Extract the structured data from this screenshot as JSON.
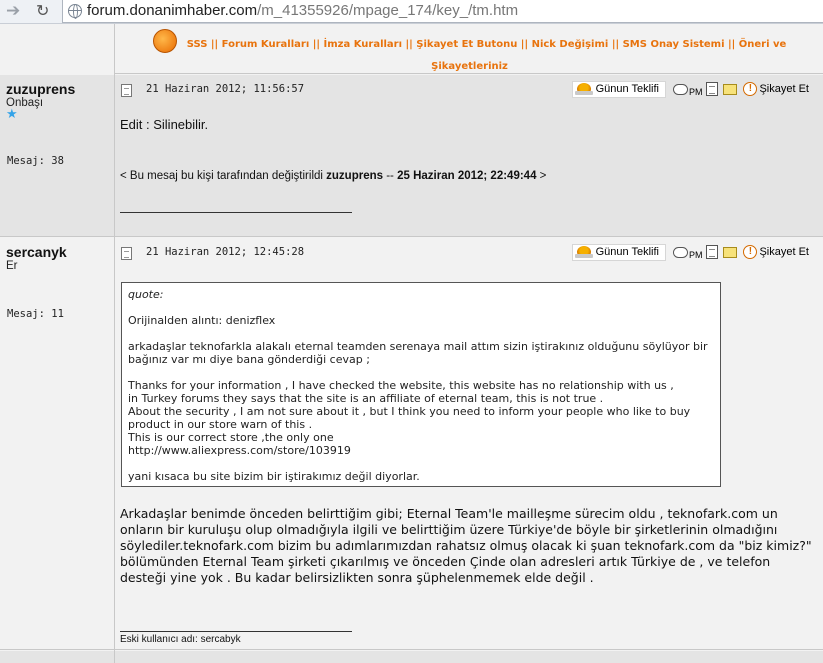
{
  "browser": {
    "url_host": "forum.donanimhaber.com",
    "url_path": "/m_41355926/mpage_174/key_/tm.htm"
  },
  "toplinks": {
    "line1": "SSS || Forum Kuralları || İmza Kuralları || Şikayet Et Butonu || Nick Değişimi || SMS Onay Sistemi || Öneri ve",
    "line2": "Şikayetleriniz"
  },
  "post_tools": {
    "offer_label": "Günun Teklifi",
    "pm_label": "PM",
    "report_label": "Şikayet Et"
  },
  "posts": [
    {
      "username": "zuzuprens",
      "rank": "Onbaşı",
      "message_count": "Mesaj: 38",
      "date": "21 Haziran 2012; 11:56:57",
      "body": "Edit : Silinebilir.",
      "edit_note_prefix": "< Bu mesaj bu kişi tarafından değiştirildi ",
      "edit_note_user": "zuzuprens",
      "edit_note_sep": " -- ",
      "edit_note_date": "25 Haziran 2012; 22:49:44",
      "edit_note_suffix": " >"
    },
    {
      "username": "sercanyk",
      "rank": "Er",
      "message_count": "Mesaj: 11",
      "date": "21 Haziran 2012; 12:45:28",
      "quote": {
        "label": "quote:",
        "source": "Orijinalden alıntı: denizflex",
        "para1": "arkadaşlar teknofarkla alakalı eternal teamden serenaya mail attım sizin iştirakınız olduğunu söylüyor bir bağınız var mı diye bana gönderdiği cevap ;",
        "para2_l1": "Thanks for your information , I have checked the website, this website has no relationship with us ,",
        "para2_l2": "in Turkey forums they says that the site is an affiliate of eternal team, this is not true .",
        "para2_l3": "About the security , I am not sure about it , but I think you need to inform your people who like to buy product in our store warn of this .",
        "para2_l4": "This is our correct store ,the only one",
        "link": "http://www.aliexpress.com/store/103919",
        "para3": "yani kısaca bu site bizim bir iştirakımız değil diyorlar."
      },
      "body": "Arkadaşlar benimde önceden belirttiğim gibi; Eternal Team'le mailleşme sürecim oldu , teknofark.com un onların bir kuruluşu olup olmadığıyla ilgili ve belirttiğim üzere Türkiye'de böyle bir şirketlerinin olmadığını söylediler.teknofark.com bizim bu adımlarımızdan rahatsız olmuş olacak ki şuan teknofark.com da \"biz kimiz?\" bölümünden Eternal Team şirketi çıkarılmış ve önceden Çinde olan adresleri artık Türkiye de , ve telefon desteği yine yok . Bu kadar belirsizlikten sonra şüphelenmemek elde değil .",
      "signature": "Eski kullanıcı adı: sercabyk"
    }
  ]
}
